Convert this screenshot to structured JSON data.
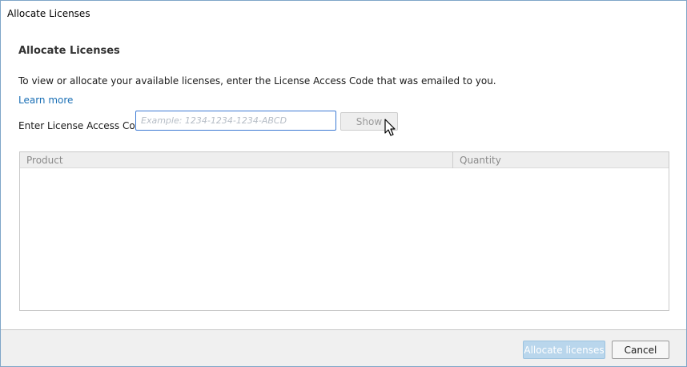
{
  "window": {
    "title": "Allocate Licenses"
  },
  "main": {
    "heading": "Allocate Licenses",
    "instructions": "To view or allocate your available licenses, enter the License Access Code that was emailed to you.",
    "learn_more": "Learn more",
    "code_label": "Enter License Access Code:",
    "code_input": {
      "value": "",
      "placeholder": "Example: 1234-1234-1234-ABCD"
    },
    "show_button": "Show"
  },
  "table": {
    "columns": [
      "Product",
      "Quantity"
    ],
    "rows": []
  },
  "footer": {
    "allocate_button": "Allocate licenses",
    "cancel_button": "Cancel"
  },
  "icons": {
    "cursor": "mouse-pointer-icon"
  },
  "colors": {
    "accent": "#1a6fb5",
    "input_border": "#3d7bd4",
    "primary_disabled": "#b9d6ec"
  }
}
